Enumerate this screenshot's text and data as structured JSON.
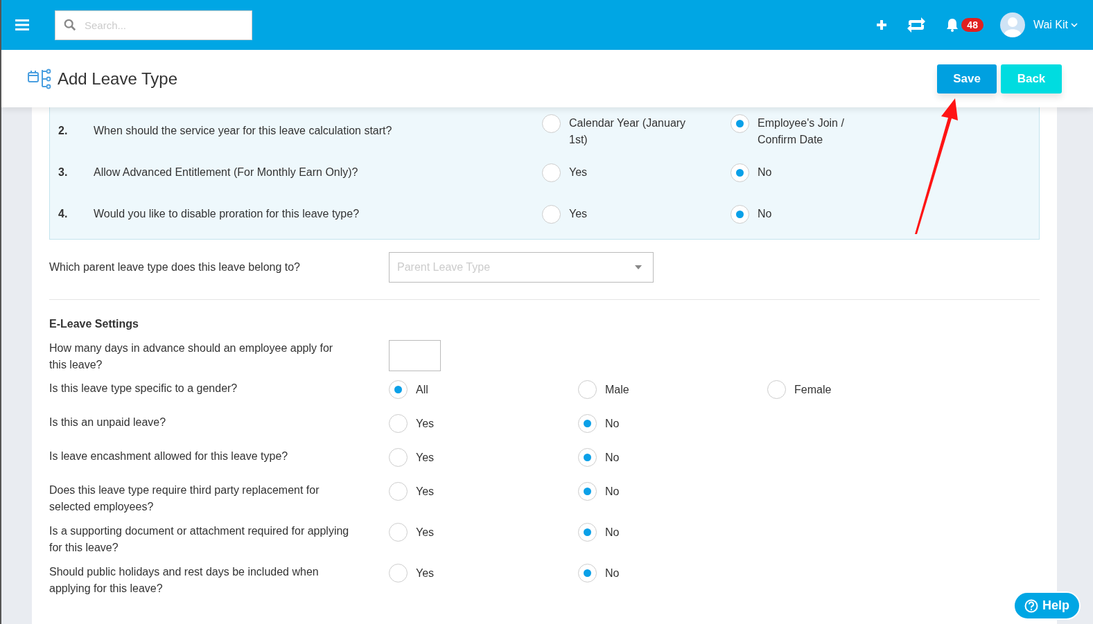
{
  "topbar": {
    "search": {
      "placeholder": "Search..."
    },
    "notifications": {
      "count": "48"
    },
    "user": {
      "name": "Wai Kit"
    }
  },
  "page_header": {
    "title": "Add Leave Type",
    "buttons": [
      {
        "label": "Save",
        "kind": "primary"
      },
      {
        "label": "Back",
        "kind": "secondary"
      }
    ]
  },
  "service_questions": [
    {
      "number": "2.",
      "question": "When should the service year for this leave calculation start?",
      "options": [
        {
          "label": "Calendar Year (January 1st)",
          "selected": false
        },
        {
          "label": "Employee's Join / Confirm Date",
          "selected": true
        }
      ]
    },
    {
      "number": "3.",
      "question": "Allow Advanced Entitlement (For Monthly Earn Only)?",
      "options": [
        {
          "label": "Yes",
          "selected": false
        },
        {
          "label": "No",
          "selected": true
        }
      ]
    },
    {
      "number": "4.",
      "question": "Would you like to disable proration for this leave type?",
      "options": [
        {
          "label": "Yes",
          "selected": false
        },
        {
          "label": "No",
          "selected": true
        }
      ]
    }
  ],
  "parent_leave": {
    "question": "Which parent leave type does this leave belong to?",
    "placeholder": "Parent Leave Type"
  },
  "eleave": {
    "title": "E-Leave Settings",
    "questions": [
      {
        "kind": "number",
        "question": "How many days in advance should an employee apply for this leave?"
      },
      {
        "kind": "radio",
        "question": "Is this leave type specific to a gender?",
        "options": [
          {
            "label": "All",
            "selected": true
          },
          {
            "label": "Male",
            "selected": false
          },
          {
            "label": "Female",
            "selected": false
          }
        ]
      },
      {
        "kind": "radio",
        "question": "Is this an unpaid leave?",
        "options": [
          {
            "label": "Yes",
            "selected": false
          },
          {
            "label": "No",
            "selected": true
          }
        ]
      },
      {
        "kind": "radio",
        "question": "Is leave encashment allowed for this leave type?",
        "options": [
          {
            "label": "Yes",
            "selected": false
          },
          {
            "label": "No",
            "selected": true
          }
        ]
      },
      {
        "kind": "radio",
        "question": "Does this leave type require third party replacement for selected employees?",
        "options": [
          {
            "label": "Yes",
            "selected": false
          },
          {
            "label": "No",
            "selected": true
          }
        ]
      },
      {
        "kind": "radio",
        "question": "Is a supporting document or attachment required for applying for this leave?",
        "options": [
          {
            "label": "Yes",
            "selected": false
          },
          {
            "label": "No",
            "selected": true
          }
        ]
      },
      {
        "kind": "radio",
        "question": "Should public holidays and rest days be included when applying for this leave?",
        "options": [
          {
            "label": "Yes",
            "selected": false
          },
          {
            "label": "No",
            "selected": true
          }
        ]
      }
    ]
  },
  "help": {
    "label": "Help"
  }
}
